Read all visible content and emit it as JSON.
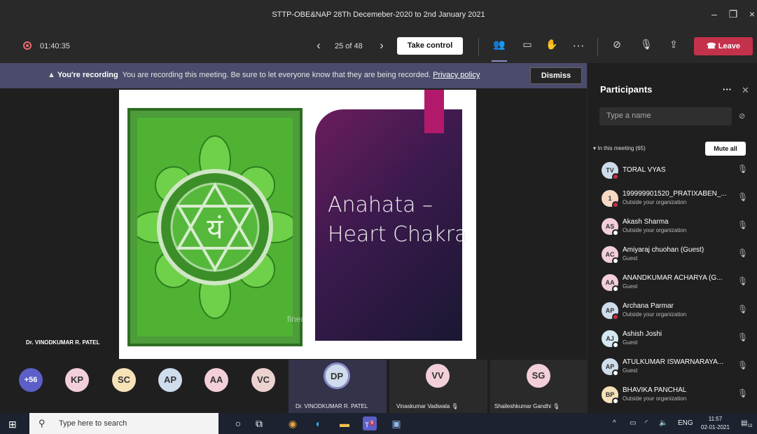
{
  "window": {
    "title": "STTP-OBE&NAP 28Th Decemeber-2020 to 2nd January 2021",
    "controls": [
      "minimize-icon",
      "maximize-icon",
      "close-icon"
    ]
  },
  "toolbar": {
    "timer": "01:40:35",
    "page_counter": "25 of 48",
    "take_control": "Take control",
    "leave": "Leave"
  },
  "banner": {
    "heading": "You're recording",
    "message": "You are recording this meeting. Be sure to let everyone know that they are being recorded.",
    "link": "Privacy policy",
    "dismiss": "Dismiss"
  },
  "slide": {
    "title_line1": "Anahata –",
    "title_line2": "Heart Chakra",
    "presenter_label": "Dr. VINODKUMAR R. PATEL",
    "watermark": "fineart",
    "chakra_glyph": "यं"
  },
  "gallery": {
    "overflow_count": "+56",
    "avatars": [
      {
        "initials": "KP",
        "color": "#f2cfd9"
      },
      {
        "initials": "SC",
        "color": "#f7e2b8"
      },
      {
        "initials": "AP",
        "color": "#cfdcec"
      },
      {
        "initials": "AA",
        "color": "#f2cfd9"
      },
      {
        "initials": "VC",
        "color": "#ead2cf"
      }
    ],
    "tiles": [
      {
        "initials": "DP",
        "name": "Dr. VINODKUMAR R. PATEL"
      },
      {
        "initials": "VV",
        "name": "Vinaskumar Vadiwala"
      },
      {
        "initials": "SG",
        "name": "Shaileshkumar Gandhi"
      }
    ]
  },
  "participants": {
    "title": "Participants",
    "search_placeholder": "Type a name",
    "section": "In this meeting (65)",
    "mute_all": "Mute all",
    "list": [
      {
        "initials": "TV",
        "name": "TORAL VYAS",
        "sub": "",
        "color": "#cfdcec",
        "dot": "#c4314b"
      },
      {
        "initials": "1",
        "name": "199999901520_PRATIXABEN_...",
        "sub": "Outside your organization",
        "color": "#f7d9c4",
        "dot": "#c4314b"
      },
      {
        "initials": "AS",
        "name": "Akash Sharma",
        "sub": "Outside your organization",
        "color": "#f2cfd9",
        "dot": "#ffffff"
      },
      {
        "initials": "AC",
        "name": "Amiyaraj chuohan (Guest)",
        "sub": "Guest",
        "color": "#f2cfd9",
        "dot": "#ffffff"
      },
      {
        "initials": "AA",
        "name": "ANANDKUMAR ACHARYA (G...",
        "sub": "Guest",
        "color": "#f2cfd9",
        "dot": "#ffffff"
      },
      {
        "initials": "AP",
        "name": "Archana Parmar",
        "sub": "Outside your organization",
        "color": "#cfdcec",
        "dot": "#c4314b"
      },
      {
        "initials": "AJ",
        "name": "Ashish Joshi",
        "sub": "Guest",
        "color": "#d4e8f0",
        "dot": "#ffffff"
      },
      {
        "initials": "AP",
        "name": "ATULKUMAR ISWARNARAYA...",
        "sub": "Guest",
        "color": "#cfdcec",
        "dot": "#ffffff"
      },
      {
        "initials": "BP",
        "name": "BHAVIKA PANCHAL",
        "sub": "Outside your organization",
        "color": "#f7e2b8",
        "dot": "#ffffff"
      }
    ]
  },
  "taskbar": {
    "search_placeholder": "Type here to search",
    "teams_badge": "9",
    "language": "ENG",
    "time": "11:57",
    "date": "02-01-2021",
    "notification_count": "13"
  }
}
